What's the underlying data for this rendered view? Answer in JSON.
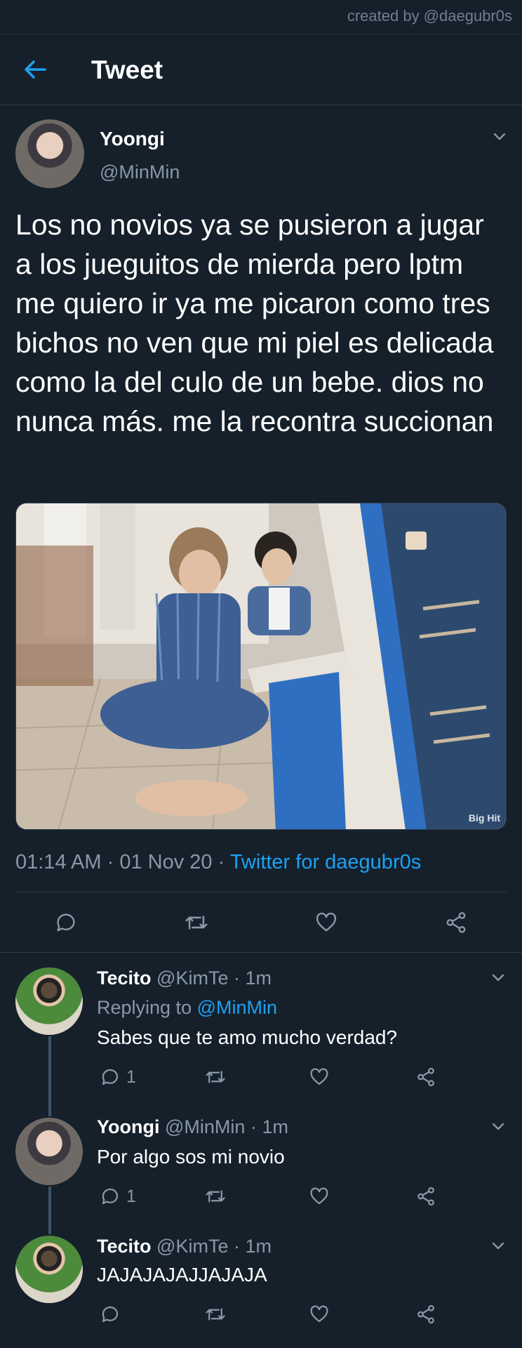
{
  "watermark": "created by @daegubr0s",
  "header": {
    "title": "Tweet"
  },
  "tweet": {
    "name": "Yoongi",
    "handle": "@MinMin",
    "text": "Los no novios ya se pusieron a jugar a los jueguitos de mierda pero lptm me quiero ir ya me picaron como tres bichos no ven que mi piel es delicada como la del culo de un bebe. dios no nunca más. me la recontra succionan",
    "photo_watermark": "Big Hit",
    "time": "01:14 AM",
    "date": "01 Nov 20",
    "source": "Twitter for daegubr0s"
  },
  "replies": [
    {
      "name": "Tecito",
      "handle": "@KimTe",
      "age": "1m",
      "replying_prefix": "Replying to ",
      "replying_to": "@MinMin",
      "text": "Sabes que te amo mucho verdad?",
      "reply_count": "1"
    },
    {
      "name": "Yoongi",
      "handle": "@MinMin",
      "age": "1m",
      "text": "Por algo sos mi novio",
      "reply_count": "1"
    },
    {
      "name": "Tecito",
      "handle": "@KimTe",
      "age": "1m",
      "text": "JAJAJAJAJJAJAJA",
      "reply_count": ""
    }
  ],
  "separator": "·",
  "colors": {
    "background": "#15202b",
    "accent": "#1da1f2",
    "secondary_text": "#8899a6",
    "divider": "#2f3d4b"
  },
  "icons": {
    "back": "arrow-left-icon",
    "more": "chevron-down-icon",
    "reply": "comment-icon",
    "retweet": "retweet-icon",
    "like": "heart-icon",
    "share": "share-icon"
  }
}
